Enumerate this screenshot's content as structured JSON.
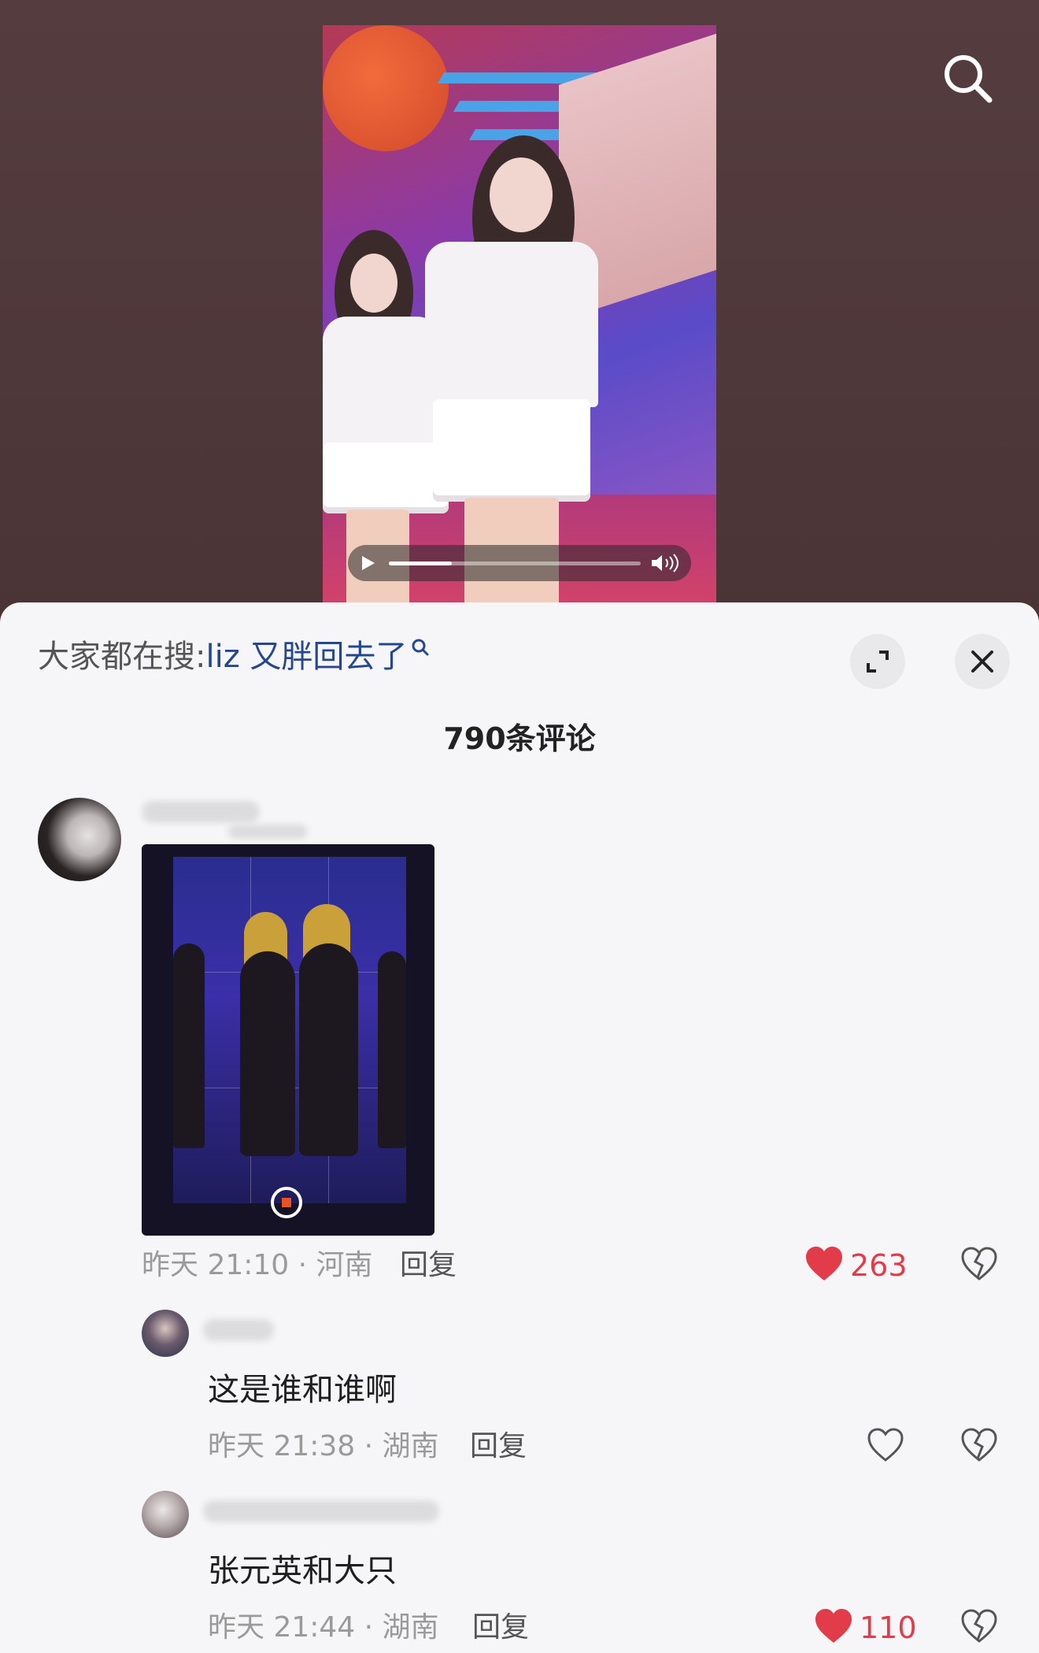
{
  "video": {
    "progress_fraction": 0.25
  },
  "hot_search": {
    "prefix": "大家都在搜:",
    "keyword": "liz 又胖回去了"
  },
  "comments_count": "790条评论",
  "comments": [
    {
      "timestamp": "昨天 21:10 · 河南",
      "reply_label": "回复",
      "likes": "263",
      "liked": true
    }
  ],
  "replies": [
    {
      "text": "这是谁和谁啊",
      "timestamp": "昨天 21:38 · 湖南",
      "reply_label": "回复",
      "likes": "",
      "liked": false
    },
    {
      "text": "张元英和大只",
      "timestamp": "昨天 21:44 · 湖南",
      "reply_label": "回复",
      "likes": "110",
      "liked": true
    }
  ],
  "colors": {
    "accent_like": "#e23c4a",
    "keyword_blue": "#24488f",
    "panel_bg": "#f6f6f8"
  }
}
